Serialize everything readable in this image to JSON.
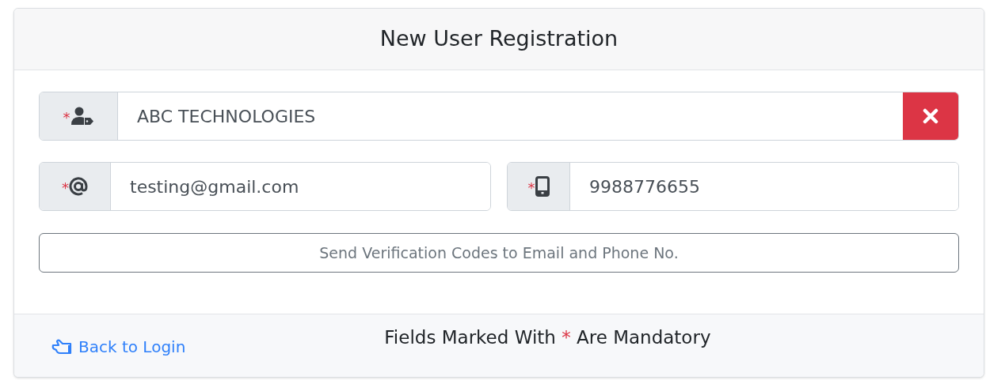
{
  "header": {
    "title": "New User Registration"
  },
  "fields": [
    {
      "kind": "company",
      "required_mark": "*",
      "value": "ABC TECHNOLOGIES",
      "clearable": true
    },
    {
      "kind": "email",
      "required_mark": "*",
      "value": "testing@gmail.com",
      "clearable": false
    },
    {
      "kind": "phone",
      "required_mark": "*",
      "value": "9988776655",
      "clearable": false
    }
  ],
  "send_button": {
    "label": "Send Verification Codes to Email and Phone No."
  },
  "footer": {
    "back_link": "Back to Login",
    "notice": {
      "before": "Fields Marked With",
      "mark": "*",
      "after": "Are Mandatory"
    }
  }
}
